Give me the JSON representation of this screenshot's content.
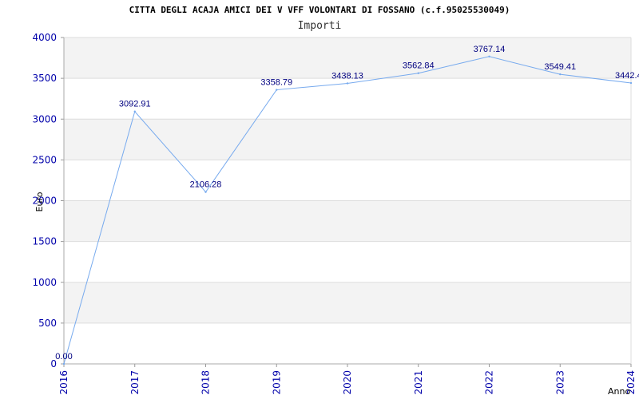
{
  "chart_data": {
    "type": "line",
    "title": "CITTA DEGLI ACAJA AMICI DEI V VFF VOLONTARI DI FOSSANO (c.f.95025530049)",
    "subtitle": "Importi",
    "xlabel": "Anno",
    "ylabel": "Euro",
    "categories": [
      "2016",
      "2017",
      "2018",
      "2019",
      "2020",
      "2021",
      "2022",
      "2023",
      "2024"
    ],
    "series": [
      {
        "values": [
          0.0,
          3092.91,
          2106.28,
          3358.79,
          3438.13,
          3562.84,
          3767.14,
          3549.41,
          3442.4
        ],
        "labels": [
          "0.00",
          "3092.91",
          "2106.28",
          "3358.79",
          "3438.13",
          "3562.84",
          "3767.14",
          "3549.41",
          "3442.4"
        ],
        "color": "#77aaee"
      }
    ],
    "ylim": [
      0,
      4000
    ],
    "yticks": [
      "0",
      "500",
      "1000",
      "1500",
      "2000",
      "2500",
      "3000",
      "3500",
      "4000"
    ],
    "grid": true,
    "band_colors": [
      "#ffffff",
      "#f3f3f3"
    ]
  }
}
